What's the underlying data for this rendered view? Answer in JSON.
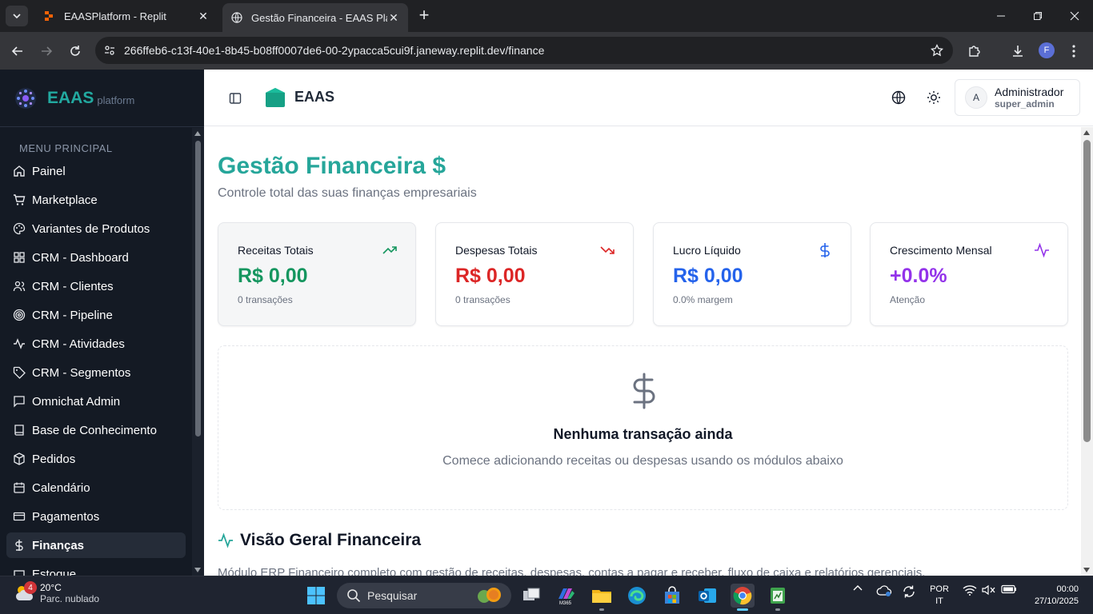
{
  "browser": {
    "tabs": [
      {
        "title": "EAASPlatform - Replit",
        "active": false
      },
      {
        "title": "Gestão Financeira - EAAS Platfo",
        "active": true
      }
    ],
    "url": "266ffeb6-c13f-40e1-8b45-b08ff0007de6-00-2ypacca5cui9f.janeway.replit.dev/finance",
    "profile_initial": "F"
  },
  "sidebar": {
    "brand": "EAAS",
    "brand_sub": "platform",
    "section": "MENU PRINCIPAL",
    "items": [
      {
        "label": "Painel",
        "icon": "home-icon"
      },
      {
        "label": "Marketplace",
        "icon": "cart-icon"
      },
      {
        "label": "Variantes de Produtos",
        "icon": "palette-icon"
      },
      {
        "label": "CRM - Dashboard",
        "icon": "dashboard-icon"
      },
      {
        "label": "CRM - Clientes",
        "icon": "users-icon"
      },
      {
        "label": "CRM - Pipeline",
        "icon": "target-icon"
      },
      {
        "label": "CRM - Atividades",
        "icon": "activity-icon"
      },
      {
        "label": "CRM - Segmentos",
        "icon": "tag-icon"
      },
      {
        "label": "Omnichat Admin",
        "icon": "chat-icon"
      },
      {
        "label": "Base de Conhecimento",
        "icon": "book-icon"
      },
      {
        "label": "Pedidos",
        "icon": "package-icon"
      },
      {
        "label": "Calendário",
        "icon": "calendar-icon"
      },
      {
        "label": "Pagamentos",
        "icon": "credit-card-icon"
      },
      {
        "label": "Finanças",
        "icon": "dollar-icon",
        "active": true
      },
      {
        "label": "Estoque",
        "icon": "box-icon"
      }
    ]
  },
  "header": {
    "title": "EAAS",
    "user_initial": "A",
    "user_name": "Administrador",
    "user_role": "super_admin"
  },
  "page": {
    "title": "Gestão Financeira $",
    "subtitle": "Controle total das suas finanças empresariais"
  },
  "cards": [
    {
      "label": "Receitas Totais",
      "value": "R$ 0,00",
      "sub": "0 transações",
      "color": "#15965f",
      "icon": "trending-up-icon"
    },
    {
      "label": "Despesas Totais",
      "value": "R$ 0,00",
      "sub": "0 transações",
      "color": "#dc2626",
      "icon": "trending-down-icon"
    },
    {
      "label": "Lucro Líquido",
      "value": "R$ 0,00",
      "sub": "0.0% margem",
      "color": "#2563eb",
      "icon": "dollar-icon"
    },
    {
      "label": "Crescimento Mensal",
      "value": "+0.0%",
      "sub": "Atenção",
      "color": "#9333ea",
      "icon": "activity-icon"
    }
  ],
  "empty_state": {
    "title": "Nenhuma transação ainda",
    "subtitle": "Comece adicionando receitas ou despesas usando os módulos abaixo"
  },
  "overview": {
    "title": "Visão Geral Financeira",
    "description": "Módulo ERP Financeiro completo com gestão de receitas, despesas, contas a pagar e receber, fluxo de caixa e relatórios gerenciais."
  },
  "taskbar": {
    "temp": "20°C",
    "condition": "Parc. nublado",
    "weather_badge": "4",
    "search_placeholder": "Pesquisar",
    "lang_line1": "POR",
    "lang_line2": "IT",
    "time": "00:00",
    "date": "27/10/2025"
  }
}
